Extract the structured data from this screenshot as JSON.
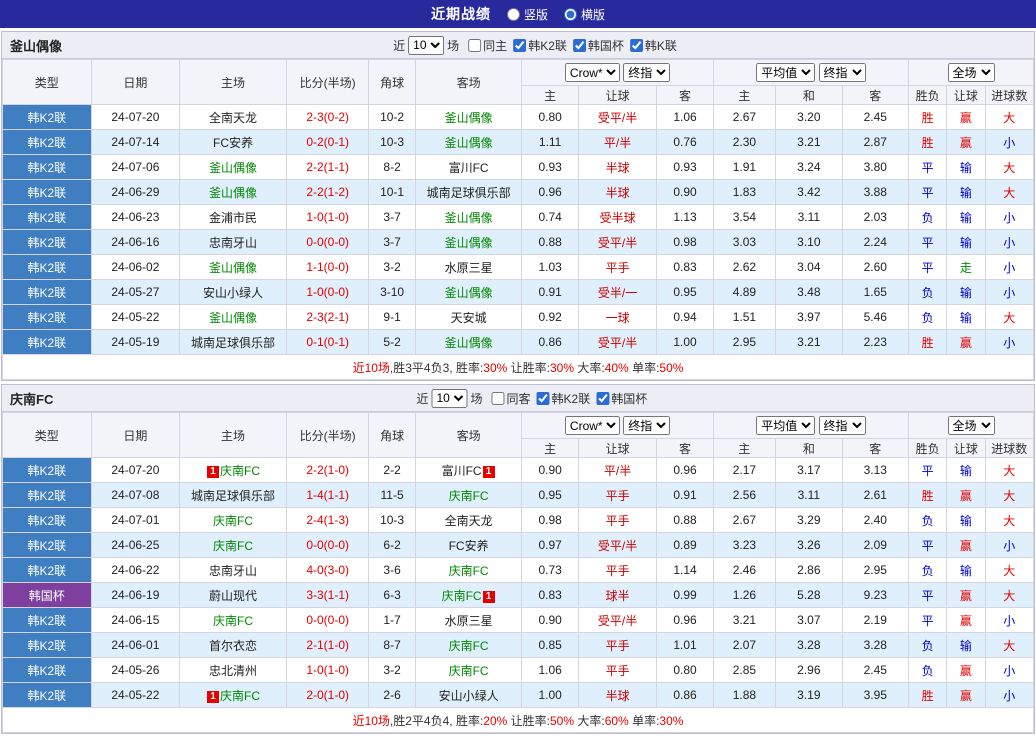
{
  "topbar": {
    "title": "近期战绩",
    "radios": [
      {
        "label": "竖版",
        "selected": false
      },
      {
        "label": "横版",
        "selected": true
      }
    ]
  },
  "filter_labels": {
    "near": "近",
    "games": "场"
  },
  "table_headers": {
    "type": "类型",
    "date": "日期",
    "home": "主场",
    "score": "比分(半场)",
    "corner": "角球",
    "away": "客场",
    "group1": [
      "Crow*",
      "终指"
    ],
    "group2": [
      "平均值",
      "终指"
    ],
    "group3": [
      "全场"
    ],
    "sub": [
      "主",
      "让球",
      "客",
      "主",
      "和",
      "客",
      "胜负",
      "让球",
      "进球数"
    ]
  },
  "league_colors": {
    "韩K2联": "#3E7EC1",
    "韩国杯": "#7E3F9E"
  },
  "value_colors": {
    "胜": "#E60000",
    "平": "#0000CC",
    "负": "#0000CC",
    "赢": "#E60000",
    "输": "#0000CC",
    "走": "#008800",
    "大": "#E60000",
    "小": "#0000CC"
  },
  "badge": "1",
  "sections": [
    {
      "team": "釜山偶像",
      "count": "10",
      "checkboxes": [
        {
          "label": "同主",
          "checked": false
        },
        {
          "label": "韩K2联",
          "checked": true
        },
        {
          "label": "韩国杯",
          "checked": true
        },
        {
          "label": "韩K联",
          "checked": true
        }
      ],
      "rows": [
        [
          "韩K2联",
          "24-07-20",
          "全南天龙",
          "",
          "2-3(0-2)",
          "10-2",
          "釜山偶像",
          "g",
          "0.80",
          "受平/半",
          "1.06",
          "2.67",
          "3.20",
          "2.45",
          "胜",
          "赢",
          "大"
        ],
        [
          "韩K2联",
          "24-07-14",
          "FC安养",
          "",
          "0-2(0-1)",
          "10-3",
          "釜山偶像",
          "g",
          "1.11",
          "平/半",
          "0.76",
          "2.30",
          "3.21",
          "2.87",
          "胜",
          "赢",
          "小"
        ],
        [
          "韩K2联",
          "24-07-06",
          "釜山偶像",
          "g",
          "2-2(1-1)",
          "8-2",
          "富川FC",
          "",
          "0.93",
          "半球",
          "0.93",
          "1.91",
          "3.24",
          "3.80",
          "平",
          "输",
          "大"
        ],
        [
          "韩K2联",
          "24-06-29",
          "釜山偶像",
          "g",
          "2-2(1-2)",
          "10-1",
          "城南足球俱乐部",
          "",
          "0.96",
          "半球",
          "0.90",
          "1.83",
          "3.42",
          "3.88",
          "平",
          "输",
          "大"
        ],
        [
          "韩K2联",
          "24-06-23",
          "金浦市民",
          "",
          "1-0(1-0)",
          "3-7",
          "釜山偶像",
          "g",
          "0.74",
          "受半球",
          "1.13",
          "3.54",
          "3.11",
          "2.03",
          "负",
          "输",
          "小"
        ],
        [
          "韩K2联",
          "24-06-16",
          "忠南牙山",
          "",
          "0-0(0-0)",
          "3-7",
          "釜山偶像",
          "g",
          "0.88",
          "受平/半",
          "0.98",
          "3.03",
          "3.10",
          "2.24",
          "平",
          "输",
          "小"
        ],
        [
          "韩K2联",
          "24-06-02",
          "釜山偶像",
          "g",
          "1-1(0-0)",
          "3-2",
          "水原三星",
          "",
          "1.03",
          "平手",
          "0.83",
          "2.62",
          "3.04",
          "2.60",
          "平",
          "走",
          "小"
        ],
        [
          "韩K2联",
          "24-05-27",
          "安山小绿人",
          "",
          "1-0(0-0)",
          "3-10",
          "釜山偶像",
          "g",
          "0.91",
          "受半/一",
          "0.95",
          "4.89",
          "3.48",
          "1.65",
          "负",
          "输",
          "小"
        ],
        [
          "韩K2联",
          "24-05-22",
          "釜山偶像",
          "g",
          "2-3(2-1)",
          "9-1",
          "天安城",
          "",
          "0.92",
          "一球",
          "0.94",
          "1.51",
          "3.97",
          "5.46",
          "负",
          "输",
          "大"
        ],
        [
          "韩K2联",
          "24-05-19",
          "城南足球俱乐部",
          "",
          "0-1(0-1)",
          "5-2",
          "釜山偶像",
          "g",
          "0.86",
          "受平/半",
          "1.00",
          "2.95",
          "3.21",
          "2.23",
          "胜",
          "赢",
          "小"
        ]
      ],
      "footer": [
        {
          "t": "近10场",
          "red": true
        },
        {
          "t": ",胜3平4负3, ",
          "red": false
        },
        {
          "t": "胜率:",
          "red": false
        },
        {
          "t": "30%",
          "red": true
        },
        {
          "t": " 让胜率:",
          "red": false
        },
        {
          "t": "30%",
          "red": true
        },
        {
          "t": " 大率:",
          "red": false
        },
        {
          "t": "40%",
          "red": true
        },
        {
          "t": " 单率:",
          "red": false
        },
        {
          "t": "50%",
          "red": true
        }
      ]
    },
    {
      "team": "庆南FC",
      "count": "10",
      "checkboxes": [
        {
          "label": "同客",
          "checked": false
        },
        {
          "label": "韩K2联",
          "checked": true
        },
        {
          "label": "韩国杯",
          "checked": true
        }
      ],
      "rows": [
        [
          "韩K2联",
          "24-07-20",
          "庆南FC",
          "gb",
          "2-2(1-0)",
          "2-2",
          "富川FC",
          "b",
          "0.90",
          "平/半",
          "0.96",
          "2.17",
          "3.17",
          "3.13",
          "平",
          "输",
          "大"
        ],
        [
          "韩K2联",
          "24-07-08",
          "城南足球俱乐部",
          "",
          "1-4(1-1)",
          "11-5",
          "庆南FC",
          "g",
          "0.95",
          "平手",
          "0.91",
          "2.56",
          "3.11",
          "2.61",
          "胜",
          "赢",
          "大"
        ],
        [
          "韩K2联",
          "24-07-01",
          "庆南FC",
          "g",
          "2-4(1-3)",
          "10-3",
          "全南天龙",
          "",
          "0.98",
          "平手",
          "0.88",
          "2.67",
          "3.29",
          "2.40",
          "负",
          "输",
          "大"
        ],
        [
          "韩K2联",
          "24-06-25",
          "庆南FC",
          "g",
          "0-0(0-0)",
          "6-2",
          "FC安养",
          "",
          "0.97",
          "受平/半",
          "0.89",
          "3.23",
          "3.26",
          "2.09",
          "平",
          "赢",
          "小"
        ],
        [
          "韩K2联",
          "24-06-22",
          "忠南牙山",
          "",
          "4-0(3-0)",
          "3-6",
          "庆南FC",
          "g",
          "0.73",
          "平手",
          "1.14",
          "2.46",
          "2.86",
          "2.95",
          "负",
          "输",
          "大"
        ],
        [
          "韩国杯",
          "24-06-19",
          "蔚山现代",
          "",
          "3-3(1-1)",
          "6-3",
          "庆南FC",
          "gb",
          "0.83",
          "球半",
          "0.99",
          "1.26",
          "5.28",
          "9.23",
          "平",
          "赢",
          "大"
        ],
        [
          "韩K2联",
          "24-06-15",
          "庆南FC",
          "g",
          "0-0(0-0)",
          "1-7",
          "水原三星",
          "",
          "0.90",
          "受平/半",
          "0.96",
          "3.21",
          "3.07",
          "2.19",
          "平",
          "赢",
          "小"
        ],
        [
          "韩K2联",
          "24-06-01",
          "首尔衣恋",
          "",
          "2-1(1-0)",
          "8-7",
          "庆南FC",
          "g",
          "0.85",
          "平手",
          "1.01",
          "2.07",
          "3.28",
          "3.28",
          "负",
          "输",
          "大"
        ],
        [
          "韩K2联",
          "24-05-26",
          "忠北清州",
          "",
          "1-0(1-0)",
          "3-2",
          "庆南FC",
          "g",
          "1.06",
          "平手",
          "0.80",
          "2.85",
          "2.96",
          "2.45",
          "负",
          "赢",
          "小"
        ],
        [
          "韩K2联",
          "24-05-22",
          "庆南FC",
          "gb",
          "2-0(1-0)",
          "2-6",
          "安山小绿人",
          "",
          "1.00",
          "半球",
          "0.86",
          "1.88",
          "3.19",
          "3.95",
          "胜",
          "赢",
          "小"
        ]
      ],
      "footer": [
        {
          "t": "近10场",
          "red": true
        },
        {
          "t": ",胜2平4负4, ",
          "red": false
        },
        {
          "t": "胜率:",
          "red": false
        },
        {
          "t": "20%",
          "red": true
        },
        {
          "t": " 让胜率:",
          "red": false
        },
        {
          "t": "50%",
          "red": true
        },
        {
          "t": " 大率:",
          "red": false
        },
        {
          "t": "60%",
          "red": true
        },
        {
          "t": " 单率:",
          "red": false
        },
        {
          "t": "30%",
          "red": true
        }
      ]
    }
  ]
}
